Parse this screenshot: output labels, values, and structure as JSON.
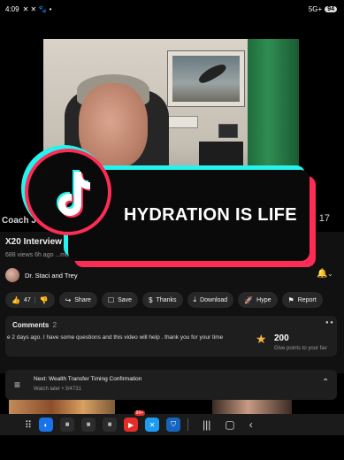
{
  "status_bar": {
    "time": "4:09",
    "left_icons": "✕ ✕ 🐾 •",
    "network": "5G+",
    "battery": "94"
  },
  "video": {
    "presenter_label": "Coach J",
    "side_count": "17"
  },
  "overlay": {
    "caption": "HYDRATION IS LIFE",
    "logo": "tiktok-logo-icon",
    "colors": {
      "cyan": "#25f4ee",
      "red": "#fe2c55"
    }
  },
  "info": {
    "title": "X20 Interview w",
    "meta": "688 views 6h ago  ...more",
    "channel": "Dr. Staci and Trey"
  },
  "actions": [
    {
      "icon": "like-icon",
      "glyph": "👍",
      "label": "47"
    },
    {
      "icon": "dislike-icon",
      "glyph": "👎",
      "label": ""
    },
    {
      "icon": "share-icon",
      "glyph": "↪",
      "label": "Share"
    },
    {
      "icon": "save-icon",
      "glyph": "☐",
      "label": "Save"
    },
    {
      "icon": "thanks-icon",
      "glyph": "$",
      "label": "Thanks"
    },
    {
      "icon": "download-icon",
      "glyph": "⤓",
      "label": "Download"
    },
    {
      "icon": "hype-icon",
      "glyph": "🚀",
      "label": "Hype"
    },
    {
      "icon": "report-icon",
      "glyph": "⚑",
      "label": "Report"
    }
  ],
  "comments": {
    "title": "Comments",
    "count": "2",
    "preview": "e 2 days ago. I have some questions and this video will help . thank you for your time",
    "points_value": "200",
    "points_text": "Give points to your fav"
  },
  "next": {
    "title": "Next: Wealth Transfer Timing Confirmation",
    "subtitle": "Watch later • 3/4731"
  },
  "taskbar": {
    "badge": "99+"
  }
}
